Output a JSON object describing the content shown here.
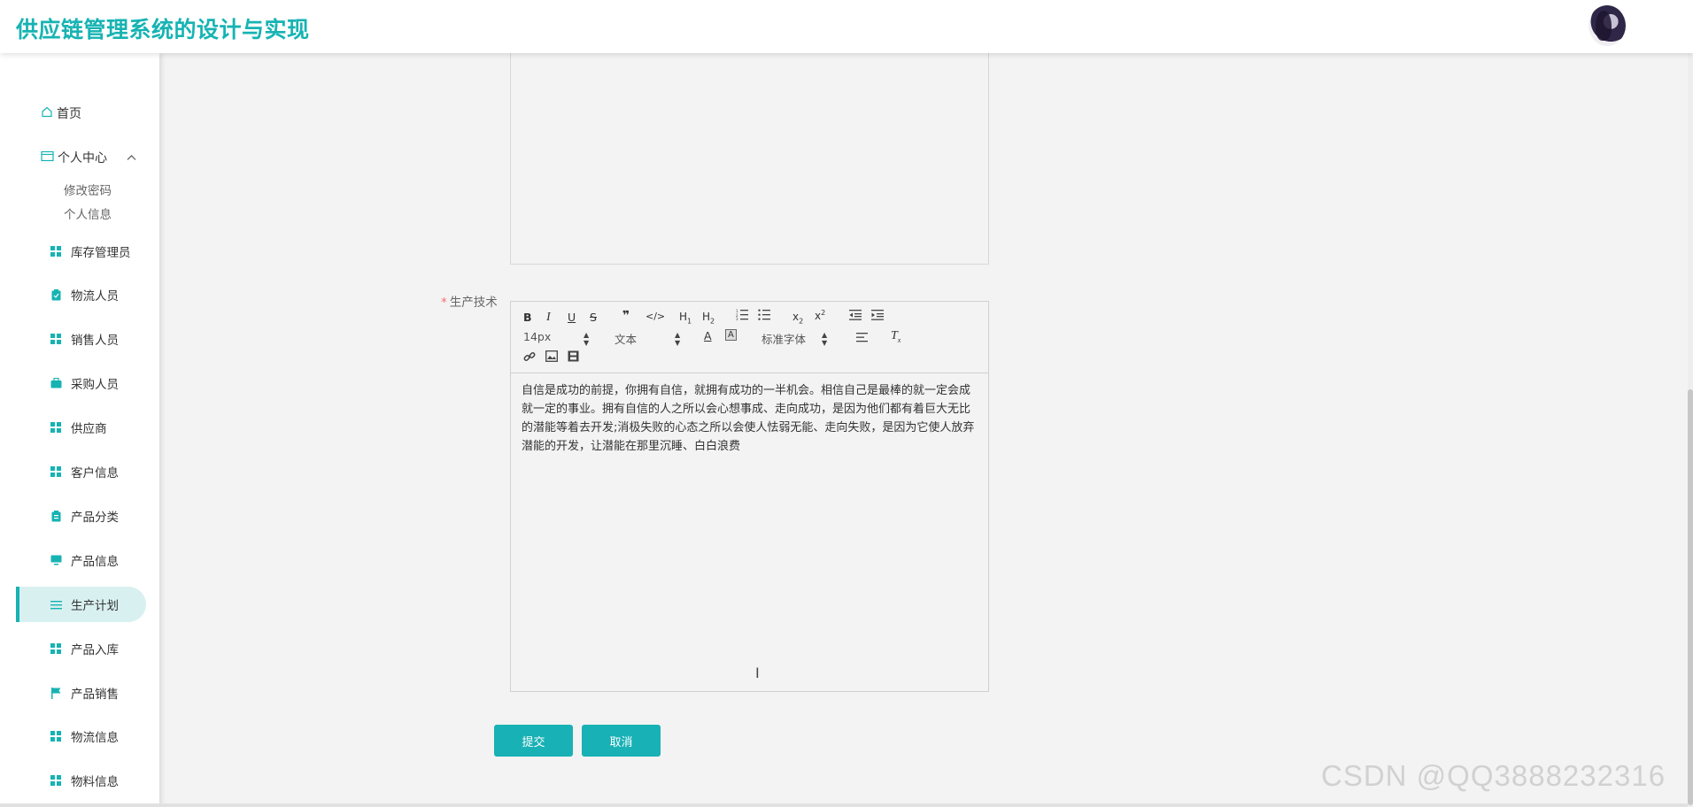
{
  "header": {
    "title": "供应链管理系统的设计与实现"
  },
  "sidebar": {
    "home": "首页",
    "personal_center": {
      "label": "个人中心",
      "children": [
        "修改密码",
        "个人信息"
      ]
    },
    "items": [
      {
        "label": "库存管理员",
        "icon": "grid-icon"
      },
      {
        "label": "物流人员",
        "icon": "clipboard-icon"
      },
      {
        "label": "销售人员",
        "icon": "grid-icon"
      },
      {
        "label": "采购人员",
        "icon": "briefcase-icon"
      },
      {
        "label": "供应商",
        "icon": "grid-icon"
      },
      {
        "label": "客户信息",
        "icon": "grid-icon"
      },
      {
        "label": "产品分类",
        "icon": "clipboard-icon"
      },
      {
        "label": "产品信息",
        "icon": "monitor-icon"
      },
      {
        "label": "生产计划",
        "icon": "list-icon",
        "active": true
      },
      {
        "label": "产品入库",
        "icon": "grid-icon"
      },
      {
        "label": "产品销售",
        "icon": "flag-icon"
      },
      {
        "label": "物流信息",
        "icon": "grid-icon"
      },
      {
        "label": "物料信息",
        "icon": "grid-icon"
      }
    ]
  },
  "form": {
    "field_label": "生产技术",
    "required_mark": "*",
    "editor": {
      "toolbar": {
        "font_size": "14px",
        "text_type": "文本",
        "font_family": "标准字体"
      },
      "content": "自信是成功的前提，你拥有自信，就拥有成功的一半机会。相信自己是最棒的就一定会成就一定的事业。拥有自信的人之所以会心想事成、走向成功，是因为他们都有着巨大无比的潜能等着去开发;消极失败的心态之所以会使人怯弱无能、走向失败，是因为它使人放弃潜能的开发，让潜能在那里沉睡、白白浪费"
    },
    "submit_label": "提交",
    "cancel_label": "取消"
  },
  "watermark": "CSDN @QQ3888232316",
  "colors": {
    "accent": "#17b3b3",
    "active_bg": "#d9f0f0",
    "button": "#18b1b5"
  }
}
